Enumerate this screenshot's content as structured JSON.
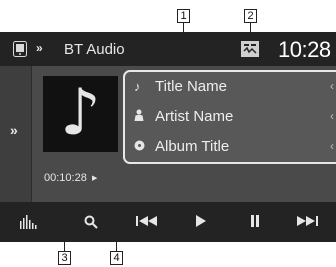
{
  "callouts": [
    "1",
    "2",
    "3",
    "4"
  ],
  "header": {
    "source_title": "BT Audio",
    "clock": "10:28"
  },
  "track": {
    "title": "Title Name",
    "artist": "Artist Name",
    "album": "Album Title",
    "elapsed": "00:10:28"
  },
  "icons": {
    "source": "phone-source-icon",
    "forward": "double-chevron-right-icon",
    "device": "bt-device-status-icon",
    "expand": "double-chevron-right-icon",
    "cover": "music-note-icon",
    "title": "music-note-icon",
    "artist": "person-icon",
    "album": "disc-icon",
    "play_status": "play-status-icon",
    "equalizer": "equalizer-icon",
    "search": "search-icon",
    "prev": "skip-previous-icon",
    "play": "play-icon",
    "pause": "pause-icon",
    "next": "skip-next-icon"
  },
  "colors": {
    "screen": "#4a4a4a",
    "bars": "#232323",
    "panel": "#585858",
    "text": "#e6e6e6"
  }
}
